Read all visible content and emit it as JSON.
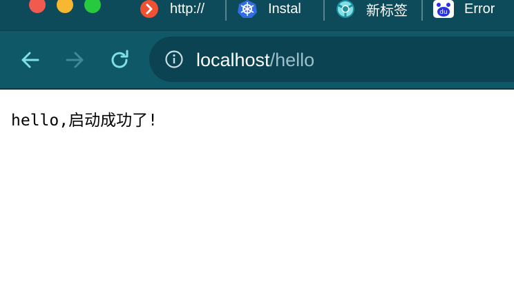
{
  "tabs": [
    {
      "title": "http://",
      "icon": "favicon-red-icon"
    },
    {
      "title": "Instal",
      "icon": "kubernetes-icon"
    },
    {
      "title": "新标签",
      "icon": "chrome-icon"
    },
    {
      "title": "Error",
      "icon": "baidu-paw-icon"
    }
  ],
  "address_bar": {
    "host": "localhost",
    "path": "/hello"
  },
  "page": {
    "body_text": "hello,启动成功了!"
  },
  "colors": {
    "tab_bar_bg": "#0d4a5a",
    "toolbar_bg": "#0f5867",
    "omnibox_bg": "#0c4352",
    "icon_accent": "#7fe0e8"
  }
}
